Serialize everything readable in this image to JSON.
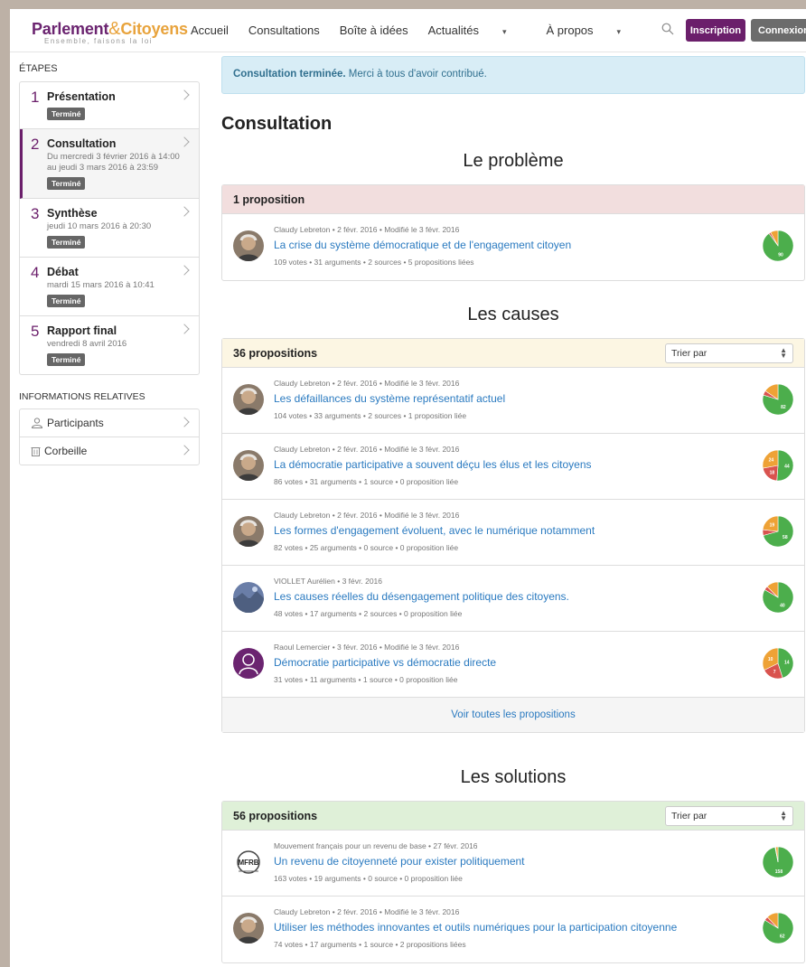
{
  "brand": {
    "name_part1": "Parlement",
    "ampersand": "&",
    "name_part2": "Citoyens",
    "tagline": "Ensemble, faisons la loi",
    "purple": "#6b2470",
    "orange": "#e8a33c"
  },
  "nav": {
    "items": [
      {
        "label": "Accueil"
      },
      {
        "label": "Consultations"
      },
      {
        "label": "Boîte à idées"
      },
      {
        "label": "Actualités",
        "caret": "▾"
      },
      {
        "label": "À propos",
        "caret": "▾"
      }
    ],
    "search_icon": "search-icon",
    "inscription": "Inscription",
    "connexion": "Connexion"
  },
  "sidebar": {
    "steps_title": "Étapes",
    "steps": [
      {
        "num": "1",
        "title": "Présentation",
        "date": "",
        "badge": "Terminé"
      },
      {
        "num": "2",
        "title": "Consultation",
        "date": "Du mercredi 3 février 2016 à 14:00 au jeudi 3 mars 2016 à 23:59",
        "badge": "Terminé"
      },
      {
        "num": "3",
        "title": "Synthèse",
        "date": "jeudi 10 mars 2016 à 20:30",
        "badge": "Terminé"
      },
      {
        "num": "4",
        "title": "Débat",
        "date": "mardi 15 mars 2016 à 10:41",
        "badge": "Terminé"
      },
      {
        "num": "5",
        "title": "Rapport final",
        "date": "vendredi 8 avril 2016",
        "badge": "Terminé"
      }
    ],
    "info_title": "Informations relatives",
    "info": [
      {
        "label": "Participants",
        "icon": "user-icon"
      },
      {
        "label": "Corbeille",
        "icon": "trash-icon"
      }
    ]
  },
  "main": {
    "alert_bold": "Consultation terminée.",
    "alert_text": " Merci à tous d'avoir contribué.",
    "heading": "Consultation",
    "sections": [
      {
        "title": "Le problème",
        "count": "1 proposition",
        "sort": "",
        "props": [
          {
            "meta": "Claudy Lebreton • 2 févr. 2016 • Modifié le 3 févr. 2016",
            "title": "La crise du système démocratique et de l'engagement citoyen",
            "stats": "109 votes • 31 arguments • 2 sources • 5 propositions liées",
            "avatar": "photo",
            "pie": [
              {
                "v": 90,
                "c": "green",
                "label": "90"
              },
              {
                "v": 8,
                "c": "orange",
                "label": ""
              },
              {
                "v": 2,
                "c": "red",
                "label": ""
              }
            ]
          }
        ]
      },
      {
        "title": "Les causes",
        "count": "36 propositions",
        "sort": "Trier par",
        "props": [
          {
            "meta": "Claudy Lebreton • 2 févr. 2016 • Modifié le 3 févr. 2016",
            "title": "Les défaillances du système représentatif actuel",
            "stats": "104 votes • 33 arguments • 2 sources • 1 proposition liée",
            "avatar": "photo",
            "pie": [
              {
                "v": 82,
                "c": "green",
                "label": "82"
              },
              {
                "v": 16,
                "c": "orange",
                "label": ""
              },
              {
                "v": 5,
                "c": "red",
                "label": ""
              }
            ]
          },
          {
            "meta": "Claudy Lebreton • 2 févr. 2016 • Modifié le 3 févr. 2016",
            "title": "La démocratie participative a souvent déçu les élus et les citoyens",
            "stats": "86 votes • 31 arguments • 1 source • 0 proposition liée",
            "avatar": "photo",
            "pie": [
              {
                "v": 44,
                "c": "green",
                "label": "44"
              },
              {
                "v": 24,
                "c": "orange",
                "label": "24"
              },
              {
                "v": 18,
                "c": "red",
                "label": "18"
              }
            ]
          },
          {
            "meta": "Claudy Lebreton • 2 févr. 2016 • Modifié le 3 févr. 2016",
            "title": "Les formes d'engagement évoluent, avec le numérique notamment",
            "stats": "82 votes • 25 arguments • 0 source • 0 proposition liée",
            "avatar": "photo",
            "pie": [
              {
                "v": 58,
                "c": "green",
                "label": "58"
              },
              {
                "v": 19,
                "c": "orange",
                "label": "19"
              },
              {
                "v": 5,
                "c": "red",
                "label": ""
              }
            ]
          },
          {
            "meta": "VIOLLET Aurélien • 3 févr. 2016",
            "title": "Les causes réelles du désengagement politique des citoyens.",
            "stats": "48 votes • 17 arguments • 2 sources • 0 proposition liée",
            "avatar": "landscape",
            "pie": [
              {
                "v": 40,
                "c": "green",
                "label": "40"
              },
              {
                "v": 6,
                "c": "orange",
                "label": ""
              },
              {
                "v": 2,
                "c": "red",
                "label": ""
              }
            ]
          },
          {
            "meta": "Raoul Lemercier • 3 févr. 2016 • Modifié le 3 févr. 2016",
            "title": "Démocratie participative vs démocratie directe",
            "stats": "31 votes • 11 arguments • 1 source • 0 proposition liée",
            "avatar": "silhouette",
            "pie": [
              {
                "v": 14,
                "c": "green",
                "label": "14"
              },
              {
                "v": 10,
                "c": "orange",
                "label": "10"
              },
              {
                "v": 7,
                "c": "red",
                "label": "7"
              }
            ]
          }
        ],
        "see_all": "Voir toutes les propositions"
      },
      {
        "title": "Les solutions",
        "count": "56 propositions",
        "sort": "Trier par",
        "props": [
          {
            "meta": "Mouvement français pour un revenu de base • 27 févr. 2016",
            "title": "Un revenu de citoyenneté pour exister politiquement",
            "stats": "163 votes • 19 arguments • 0 source • 0 proposition liée",
            "avatar": "mfrb",
            "avatar_text": "MFRB",
            "pie": [
              {
                "v": 158,
                "c": "green",
                "label": "158"
              },
              {
                "v": 4,
                "c": "orange",
                "label": ""
              },
              {
                "v": 1,
                "c": "red",
                "label": ""
              }
            ]
          },
          {
            "meta": "Claudy Lebreton • 2 févr. 2016 • Modifié le 3 févr. 2016",
            "title": "Utiliser les méthodes innovantes et outils numériques pour la participation citoyenne",
            "stats": "74 votes • 17 arguments • 1 source • 2 propositions liées",
            "avatar": "photo",
            "pie": [
              {
                "v": 62,
                "c": "green",
                "label": "62"
              },
              {
                "v": 9,
                "c": "orange",
                "label": ""
              },
              {
                "v": 3,
                "c": "red",
                "label": ""
              }
            ]
          }
        ]
      }
    ]
  },
  "colors": {
    "green": "#4cae4c",
    "orange": "#eea236",
    "red": "#d9534f",
    "link": "#2a7ac0"
  }
}
